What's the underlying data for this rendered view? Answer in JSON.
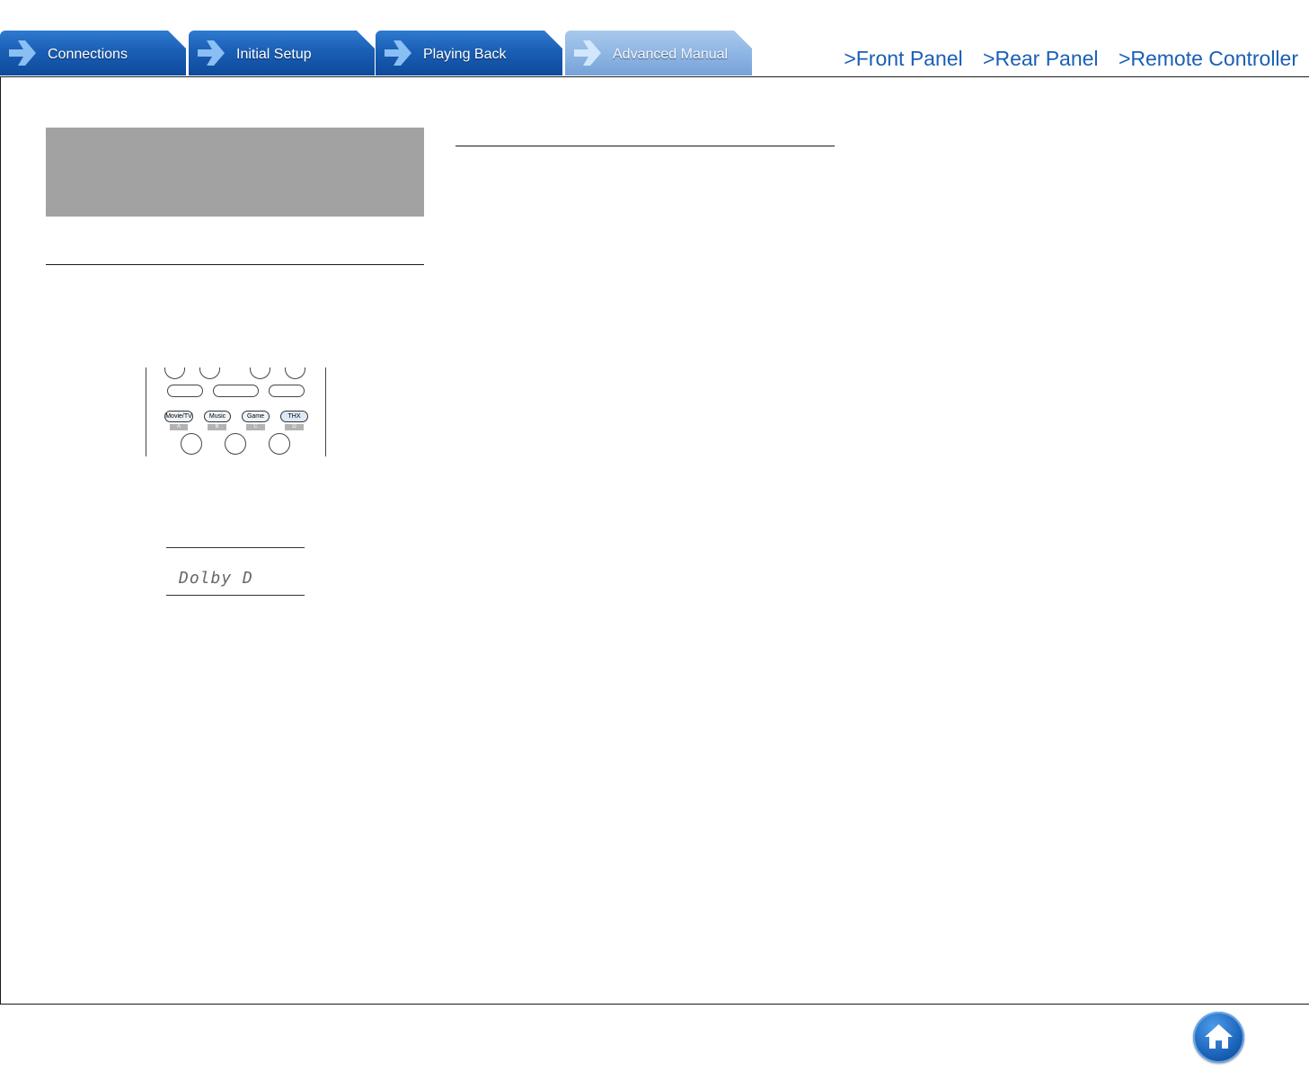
{
  "tabs": [
    {
      "label": "Connections",
      "active": false
    },
    {
      "label": "Initial Setup",
      "active": false
    },
    {
      "label": "Playing Back",
      "active": false
    },
    {
      "label": "Advanced Manual",
      "active": true
    }
  ],
  "links": [
    {
      "label": ">Front Panel"
    },
    {
      "label": ">Rear Panel"
    },
    {
      "label": ">Remote Controller"
    }
  ],
  "remote": {
    "mode_buttons": [
      {
        "label": "Movie/TV",
        "letter": "A"
      },
      {
        "label": "Music",
        "letter": "B"
      },
      {
        "label": "Game",
        "letter": "C"
      },
      {
        "label": "THX",
        "letter": "D"
      }
    ]
  },
  "display": {
    "text": "Dolby D"
  },
  "colors": {
    "tab_blue": "#1a5fb5",
    "tab_active": "#8fb6e4",
    "link_blue": "#1a5fb5",
    "gray_box": "#a2a2a2"
  },
  "icons": {
    "tab_arrow": "arrow-right-icon",
    "home": "home-icon"
  }
}
